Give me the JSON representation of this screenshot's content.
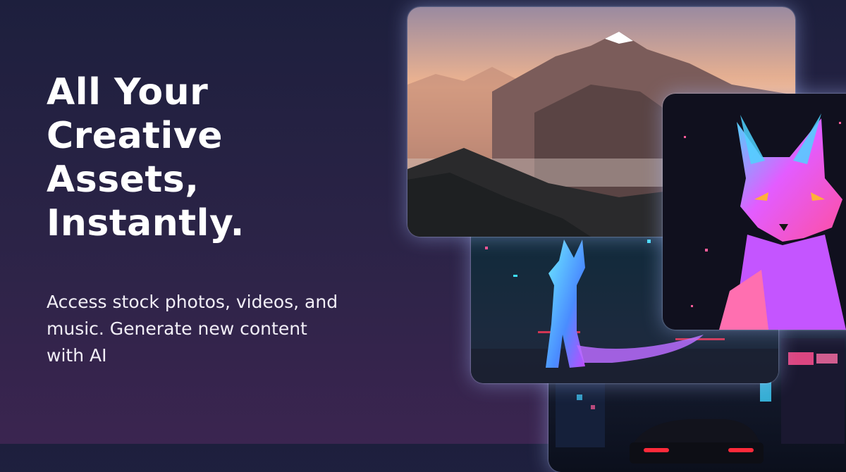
{
  "hero": {
    "headline_lines": [
      "All Your",
      "Creative",
      "Assets,",
      "Instantly."
    ],
    "subtitle": "Access stock photos, videos, and music. Generate new content with AI"
  },
  "colors": {
    "background_top": "#1d1f3d",
    "background_bottom": "#3b2550",
    "text": "#ffffff",
    "card_glow": "#aabeff"
  },
  "gallery": {
    "cards": [
      {
        "subject": "misty mountain range at sunset"
      },
      {
        "subject": "low-poly pink and blue fox portrait"
      },
      {
        "subject": "low-poly glowing fox sitting in neon street"
      },
      {
        "subject": "neon city street with car at night"
      }
    ]
  }
}
